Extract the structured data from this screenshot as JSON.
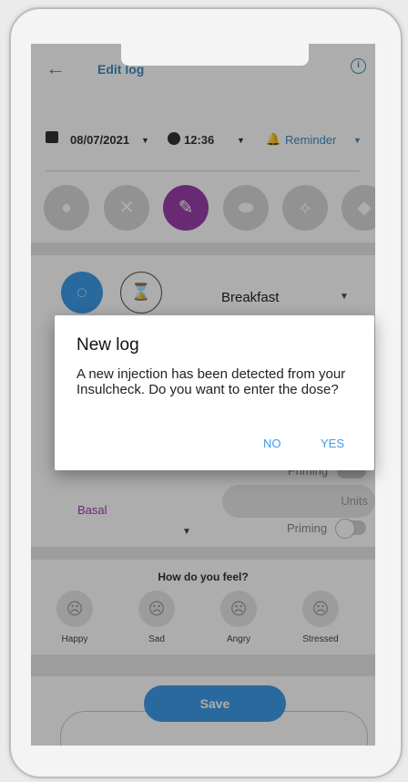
{
  "header": {
    "back_icon": "arrow-left-icon",
    "title": "Edit log",
    "info_icon": "info-icon"
  },
  "datetime": {
    "date": "08/07/2021",
    "time": "12:36",
    "reminder": "Reminder"
  },
  "categories": [
    {
      "icon": "blood-drop-icon",
      "glyph": "●"
    },
    {
      "icon": "fork-knife-icon",
      "glyph": "✕"
    },
    {
      "icon": "syringe-icon",
      "glyph": "✎",
      "active": true
    },
    {
      "icon": "pill-icon",
      "glyph": "⬬"
    },
    {
      "icon": "running-icon",
      "glyph": "⟡"
    },
    {
      "icon": "drop-icon",
      "glyph": "◆"
    }
  ],
  "meal": {
    "selected": "Breakfast"
  },
  "insulin": {
    "type": "Basal",
    "units_placeholder": "Units",
    "priming_label": "Priming",
    "priming_label_top": "Priming"
  },
  "feelings": {
    "title": "How do you feel?",
    "items": [
      {
        "label": "Happy"
      },
      {
        "label": "Sad"
      },
      {
        "label": "Angry"
      },
      {
        "label": "Stressed"
      }
    ]
  },
  "save_label": "Save",
  "dialog": {
    "title": "New log",
    "body": "A new injection has been detected from your Insulcheck. Do you want to enter the dose?",
    "no_label": "NO",
    "yes_label": "YES"
  },
  "colors": {
    "accent": "#3d9be9",
    "purple": "#9a3fa8"
  }
}
